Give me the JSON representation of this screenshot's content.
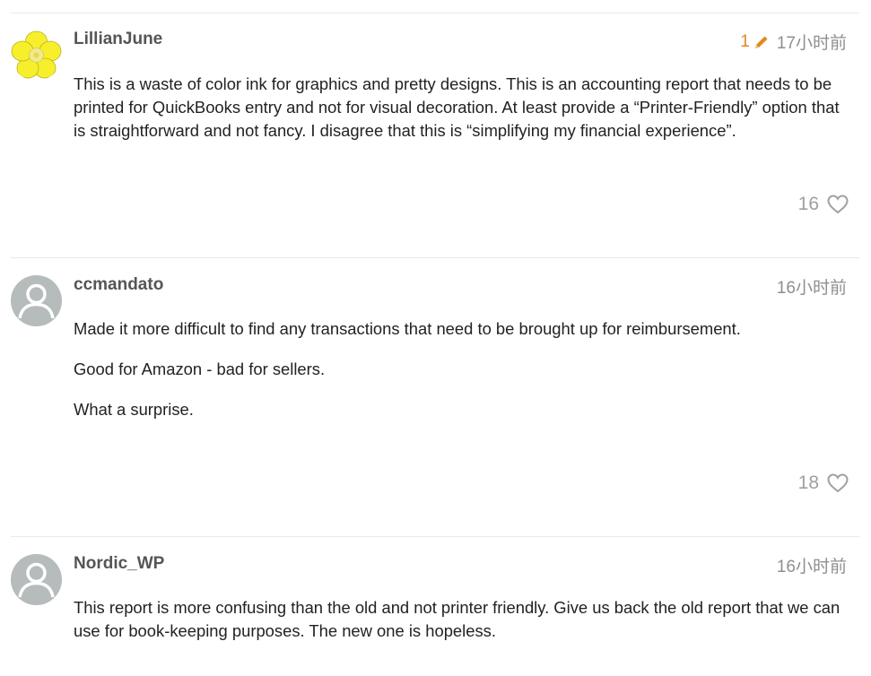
{
  "posts": [
    {
      "username": "LillianJune",
      "edit_count": "1",
      "timestamp": "17小时前",
      "paragraphs": [
        "This is a waste of color ink for graphics and pretty designs. This is an accounting report that needs to be printed for QuickBooks entry and not for visual decoration. At least provide a “Printer-Friendly” option that is straightforward and not fancy. I disagree that this is “simplifying my financial experience”."
      ],
      "like_count": "16",
      "avatar_icon": "yellow-flower-avatar"
    },
    {
      "username": "ccmandato",
      "timestamp": "16小时前",
      "paragraphs": [
        "Made it more difficult to find any transactions that need to be brought up for reimbursement.",
        "Good for Amazon - bad for sellers.",
        "What a surprise."
      ],
      "like_count": "18",
      "avatar_icon": "default-user-avatar"
    },
    {
      "username": "Nordic_WP",
      "timestamp": "16小时前",
      "paragraphs": [
        "This report is more confusing than the old and not printer friendly. Give us back the old report that we can use for book-keeping purposes. The new one is hopeless."
      ],
      "avatar_icon": "default-user-avatar"
    }
  ],
  "colors": {
    "accent_edit": "#e08a1e",
    "meta_gray": "#8f8f8f",
    "username_gray": "#555555",
    "divider": "#e9e9e9"
  }
}
